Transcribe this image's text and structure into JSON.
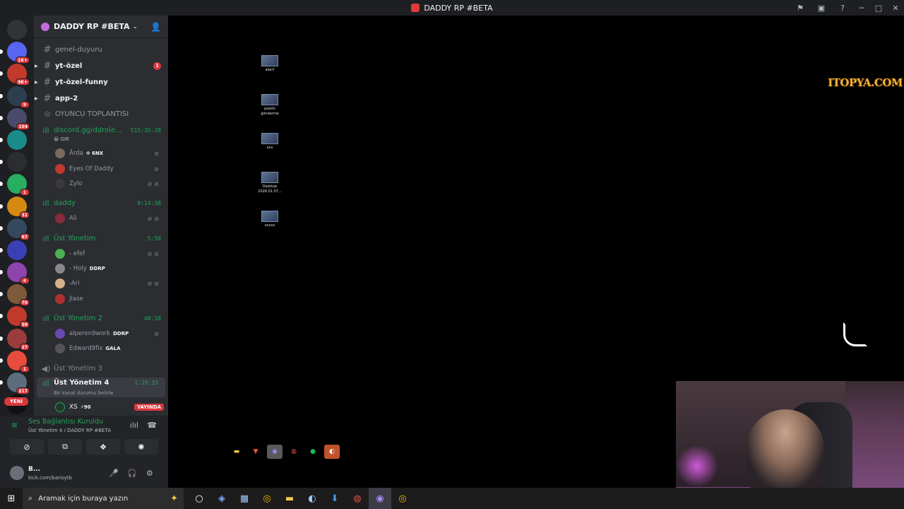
{
  "window": {
    "title": "DADDY RP #BETA"
  },
  "servers": [
    {
      "badge": "1K+",
      "color": "#5865f2"
    },
    {
      "badge": "9K+",
      "color": "#c0392b"
    },
    {
      "badge": "9",
      "color": "#2c3e50"
    },
    {
      "badge": "194",
      "color": "#4a4a6a"
    },
    {
      "badge": "",
      "color": "#1a8a8a"
    },
    {
      "badge": "",
      "color": "#2b2d31"
    },
    {
      "badge": "1",
      "color": "#27ae60"
    },
    {
      "badge": "31",
      "color": "#d68910"
    },
    {
      "badge": "67",
      "color": "#34495e"
    },
    {
      "badge": "",
      "color": "#3b3fb4"
    },
    {
      "badge": "4",
      "color": "#8e44ad"
    },
    {
      "badge": "70",
      "color": "#7f5a3a"
    },
    {
      "badge": "56",
      "color": "#c0392b"
    },
    {
      "badge": "27",
      "color": "#9b3b3b"
    },
    {
      "badge": "1",
      "color": "#e74c3c"
    },
    {
      "badge": "217",
      "color": "#5d6d7e"
    },
    {
      "badge": "",
      "color": "#111111"
    }
  ],
  "new_label": "YENİ",
  "guild": {
    "name": "DADDY RP #BETA"
  },
  "channels": {
    "genel": "genel-duyuru",
    "ytozel": "yt-özel",
    "ytozel_mention": "1",
    "ytfunny": "yt-özel-funny",
    "app2": "app-2",
    "oyuncu": "OYUNCU TOPLANTISI",
    "discord_vc": "discord.gg/ddrole...",
    "discord_timer": "515:35:28",
    "gir": "GIR",
    "daddy_vc": "daddy",
    "daddy_timer": "9:14:38",
    "ust1": "Üst Yönetim",
    "ust1_timer": "5:50",
    "ust2": "Üst Yönetim 2",
    "ust2_timer": "48:10",
    "ust3": "Üst Yönetim 3",
    "ust4": "Üst Yönetim 4",
    "ust4_timer": "1:29:33",
    "ust4_status": "Bir kanal durumu belirle"
  },
  "users": {
    "arda": "Ārda",
    "arda_tag": "✜ 6NX",
    "eyes": "Eyes Of Daddy",
    "zylo": "Zylo",
    "ali": "Ali",
    "efef": "- efef",
    "holy": "- Holy",
    "holy_tag": "DDRP",
    "ari": "-Ari",
    "jlase": "Jlase",
    "alperen": "alperen9work",
    "alperen_tag": "DDRP",
    "edward": "Edward9fix",
    "edward_tag": "GALA",
    "xs": "XS",
    "xs_tag": "⚡90",
    "live": "YAYINDA"
  },
  "voice": {
    "status": "Ses Bağlantısı Kuruldu",
    "location": "Üst Yönetim 4 / DADDY RP #BETA"
  },
  "me": {
    "name": "B...",
    "status": "kick.com/barisytb"
  },
  "desktop_icons": [
    {
      "label": "akart"
    },
    {
      "label": "paleto gönderme"
    },
    {
      "label": "xxx"
    },
    {
      "label": "Desktop 2026.01.07..."
    },
    {
      "label": "xxxxx"
    }
  ],
  "watermark": "ITOPYA.COM",
  "taskbar": {
    "search_placeholder": "Aramak için buraya yazın"
  }
}
